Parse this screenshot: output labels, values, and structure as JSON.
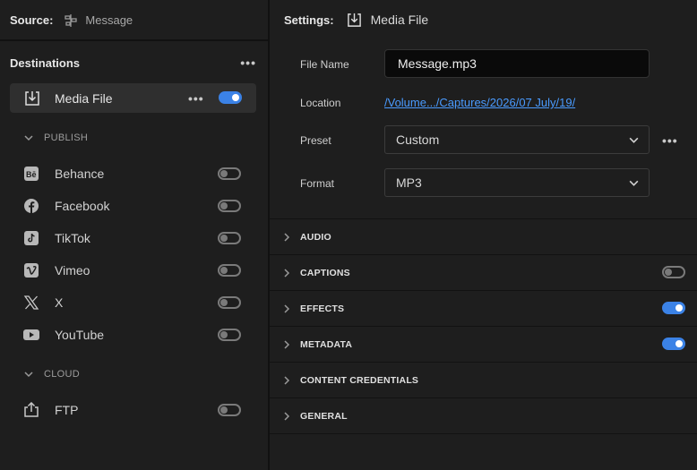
{
  "source": {
    "label": "Source:",
    "value": "Message",
    "icon": "sequence-icon"
  },
  "destinations": {
    "title": "Destinations",
    "more_label": "•••",
    "active": {
      "label": "Media File",
      "icon": "export-icon",
      "enabled": true
    },
    "groups": [
      {
        "label": "PUBLISH",
        "items": [
          {
            "label": "Behance",
            "icon": "behance-icon",
            "enabled": false
          },
          {
            "label": "Facebook",
            "icon": "facebook-icon",
            "enabled": false
          },
          {
            "label": "TikTok",
            "icon": "tiktok-icon",
            "enabled": false
          },
          {
            "label": "Vimeo",
            "icon": "vimeo-icon",
            "enabled": false
          },
          {
            "label": "X",
            "icon": "x-icon",
            "enabled": false
          },
          {
            "label": "YouTube",
            "icon": "youtube-icon",
            "enabled": false
          }
        ]
      },
      {
        "label": "CLOUD",
        "items": [
          {
            "label": "FTP",
            "icon": "upload-icon",
            "enabled": false
          }
        ]
      }
    ]
  },
  "settings": {
    "label": "Settings:",
    "target": "Media File",
    "fields": {
      "file_name_label": "File Name",
      "file_name_value": "Message.mp3",
      "location_label": "Location",
      "location_value": "/Volume.../Captures/2026/07 July/19/",
      "preset_label": "Preset",
      "preset_value": "Custom",
      "format_label": "Format",
      "format_value": "MP3"
    },
    "sections": [
      {
        "label": "AUDIO",
        "toggle": null
      },
      {
        "label": "CAPTIONS",
        "toggle": false
      },
      {
        "label": "EFFECTS",
        "toggle": true
      },
      {
        "label": "METADATA",
        "toggle": true
      },
      {
        "label": "CONTENT CREDENTIALS",
        "toggle": null
      },
      {
        "label": "GENERAL",
        "toggle": null
      }
    ]
  },
  "colors": {
    "accent": "#3b82e6",
    "link": "#4a9bff",
    "panel": "#1e1e1e",
    "selected_row": "#2f2f2f"
  }
}
